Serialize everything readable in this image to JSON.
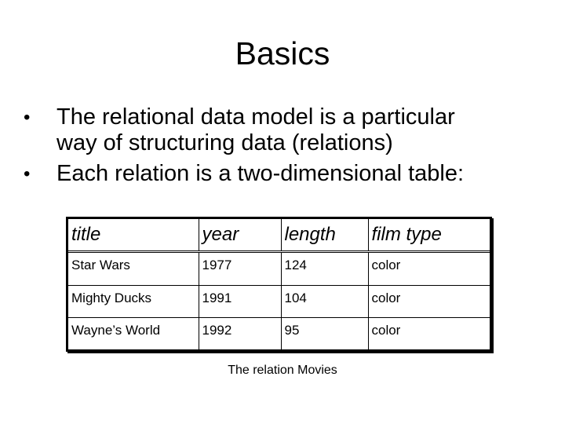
{
  "slide": {
    "title": "Basics",
    "bullets": [
      {
        "icon": "bullet-dot",
        "text_line1": "The relational data model is a particular",
        "text_line2": "way of structuring data (relations)"
      },
      {
        "icon": "bullet-dot",
        "text_line1": "Each relation is a two-dimensional table:"
      }
    ],
    "table": {
      "headers": [
        "title",
        "year",
        "length",
        "film type"
      ],
      "rows": [
        [
          "Star Wars",
          "1977",
          "124",
          "color"
        ],
        [
          "Mighty Ducks",
          "1991",
          "104",
          "color"
        ],
        [
          "Wayne’s World",
          "1992",
          "95",
          "color"
        ]
      ]
    },
    "caption": "The relation Movies"
  }
}
